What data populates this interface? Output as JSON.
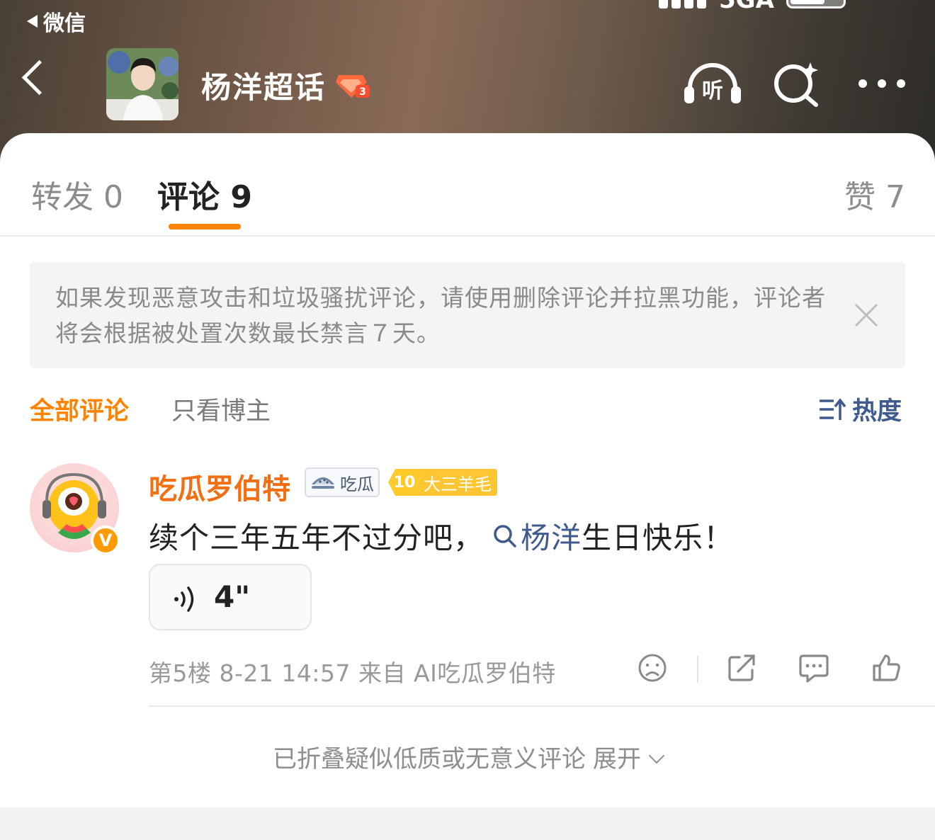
{
  "status_bar": {
    "back_app": "微信",
    "network": "5GA"
  },
  "header": {
    "title": "杨洋超话",
    "badge_level": "3",
    "listen_label": "听"
  },
  "tabs": [
    {
      "label": "转发",
      "count": "0"
    },
    {
      "label": "评论",
      "count": "9"
    },
    {
      "label": "赞",
      "count": "7"
    }
  ],
  "notice": {
    "text": "如果发现恶意攻击和垃圾骚扰评论，请使用删除评论并拉黑功能，评论者将会根据被处置次数最长禁言７天。"
  },
  "filter": {
    "all": "全部评论",
    "author_only": "只看博主",
    "sort": "热度"
  },
  "comment": {
    "username": "吃瓜罗伯特",
    "verified": "V",
    "tag1": "吃瓜",
    "tag2_level": "10",
    "tag2_name": "大三羊毛",
    "text_before": "续个三年五年不过分吧，",
    "link_text": "杨洋",
    "text_after": "生日快乐！",
    "voice_duration": "4\"",
    "floor": "第5楼",
    "time": "8-21 14:57",
    "source": "来自 AI吃瓜罗伯特"
  },
  "folded": {
    "text": "已折叠疑似低质或无意义评论",
    "expand": "展开"
  },
  "colors": {
    "accent": "#ff8200",
    "link": "#3f5a8c",
    "username": "#f26f13"
  }
}
